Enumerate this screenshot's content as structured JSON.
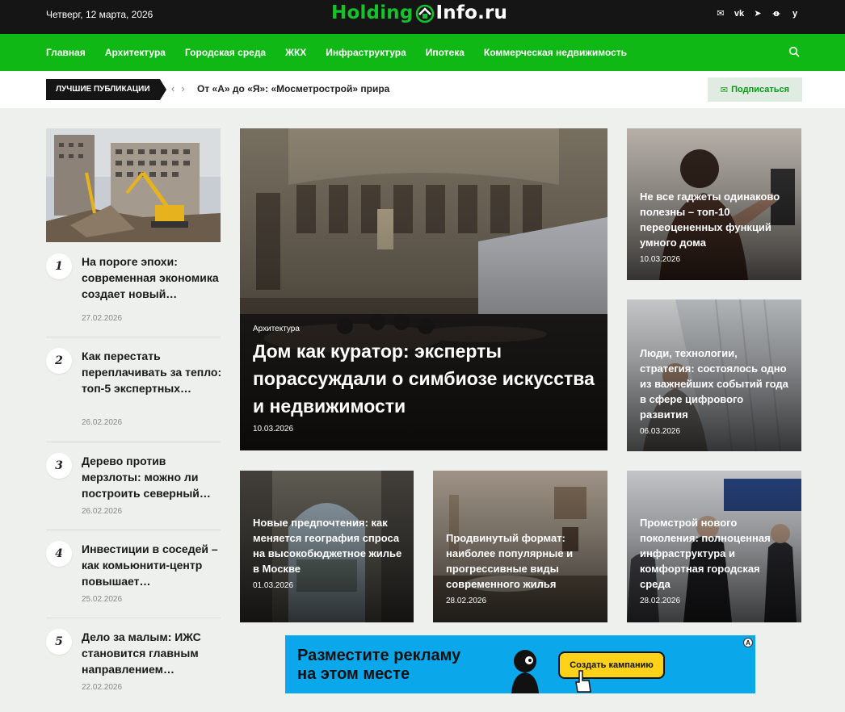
{
  "header": {
    "date": "Четверг, 12 марта, 2026",
    "logo_part1": "Holding",
    "logo_part2": "Info.ru",
    "socials": [
      "mail-icon",
      "vk-icon",
      "telegram-icon",
      "ok-icon",
      "yandex-icon"
    ]
  },
  "nav": {
    "items": [
      "Главная",
      "Архитектура",
      "Городская среда",
      "ЖКХ",
      "Инфраструктура",
      "Ипотека",
      "Коммерческая недвижимость"
    ]
  },
  "ticker": {
    "label": "Лучшие публикации",
    "headline": "От «А» до «Я»: «Мосметрострой» прира",
    "subscribe": "Подписаться"
  },
  "top_list": [
    {
      "num": "1",
      "title": "На пороге эпохи: современная экономика создает новый…",
      "date": "27.02.2026"
    },
    {
      "num": "2",
      "title": "Как перестать переплачивать за тепло: топ-5 экспертных…",
      "date": "26.02.2026"
    },
    {
      "num": "3",
      "title": "Дерево против мерзлоты: можно ли построить северный…",
      "date": "26.02.2026"
    },
    {
      "num": "4",
      "title": "Инвестиции в соседей – как комьюнити-центр повышает…",
      "date": "25.02.2026"
    },
    {
      "num": "5",
      "title": "Дело за малым: ИЖС становится главным направлением…",
      "date": "22.02.2026"
    }
  ],
  "featured": {
    "category": "Архитектура",
    "title": "Дом как куратор: эксперты порассуждали о симбиозе искусства и недвижимости",
    "date": "10.03.2026"
  },
  "side_tiles": [
    {
      "title": "Не все гаджеты одинаково полезны – топ-10 переоцененных функций умного дома",
      "date": "10.03.2026"
    },
    {
      "title": "Люди, технологии, стратегия: состоялось одно из важнейших событий года в сфере цифрового развития",
      "date": "06.03.2026"
    }
  ],
  "bottom_tiles": [
    {
      "title": "Новые предпочтения: как меняется география спроса на высокобюджетное жилье в Москве",
      "date": "01.03.2026"
    },
    {
      "title": "Продвинутый формат: наиболее популярные и прогрессивные виды современного жилья",
      "date": "28.02.2026"
    },
    {
      "title": "Промстрой нового поколения: полноценная инфраструктура и комфортная городская среда",
      "date": "28.02.2026"
    }
  ],
  "ad": {
    "line1": "Разместите рекламу",
    "line2": "на этом месте",
    "button": "Создать кампанию",
    "badge": "A"
  },
  "colors": {
    "brand_green": "#0fb814",
    "topbar": "#151515",
    "page_bg": "#edf0ec",
    "ad_bg": "#0aa7ea"
  }
}
